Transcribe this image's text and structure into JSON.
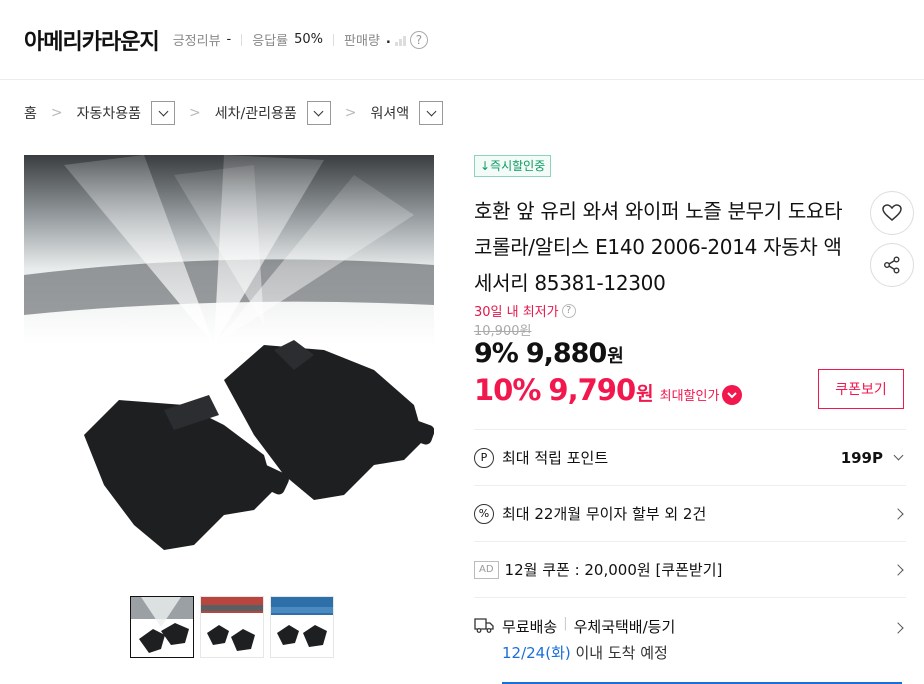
{
  "store": {
    "name": "아메리카라운지",
    "positive_review_label": "긍정리뷰",
    "positive_review_value": "-",
    "response_label": "응답률",
    "response_value": "50%",
    "sales_label": "판매량",
    "sales_value": ".",
    "help_icon": "question-circle-icon"
  },
  "breadcrumb": [
    {
      "label": "홈"
    },
    {
      "label": "자동차용품"
    },
    {
      "label": "세차/관리용품"
    },
    {
      "label": "워셔액"
    }
  ],
  "product": {
    "instant_badge": "↓즉시할인중",
    "title": "호환 앞 유리 와셔 와이퍼 노즐 분무기 도요타 코롤라/알티스 E140 2006-2014 자동차 액세서리 85381-12300",
    "lowest_label": "30일 내 최저가",
    "original_price": "10,900원",
    "discount1_pct": "9%",
    "discount1_price": "9,880",
    "won": "원",
    "discount2_pct": "10%",
    "discount2_price": "9,790",
    "max_discount_label": "최대할인가",
    "coupon_button": "쿠폰보기"
  },
  "rows": {
    "points_label": "최대 적립 포인트",
    "points_value": "199P",
    "installment": "최대 22개월 무이자 할부 외 2건",
    "ad_badge": "AD",
    "coupon_ad": "12월 쿠폰 : 20,000원 [쿠폰받기]",
    "shipping_free": "무료배송",
    "shipping_carrier": "우체국택배/등기",
    "arrival_date": "12/24(화)",
    "arrival_suffix": " 이내 도착 예정"
  },
  "icons": {
    "wishlist": "heart-icon",
    "share": "share-icon",
    "points": "p-circle-icon",
    "installment": "percent-circle-icon",
    "shipping": "truck-icon"
  },
  "colors": {
    "sale_red": "#f2174d",
    "instant_green": "#0b9a63",
    "date_blue": "#1a6fd8"
  }
}
